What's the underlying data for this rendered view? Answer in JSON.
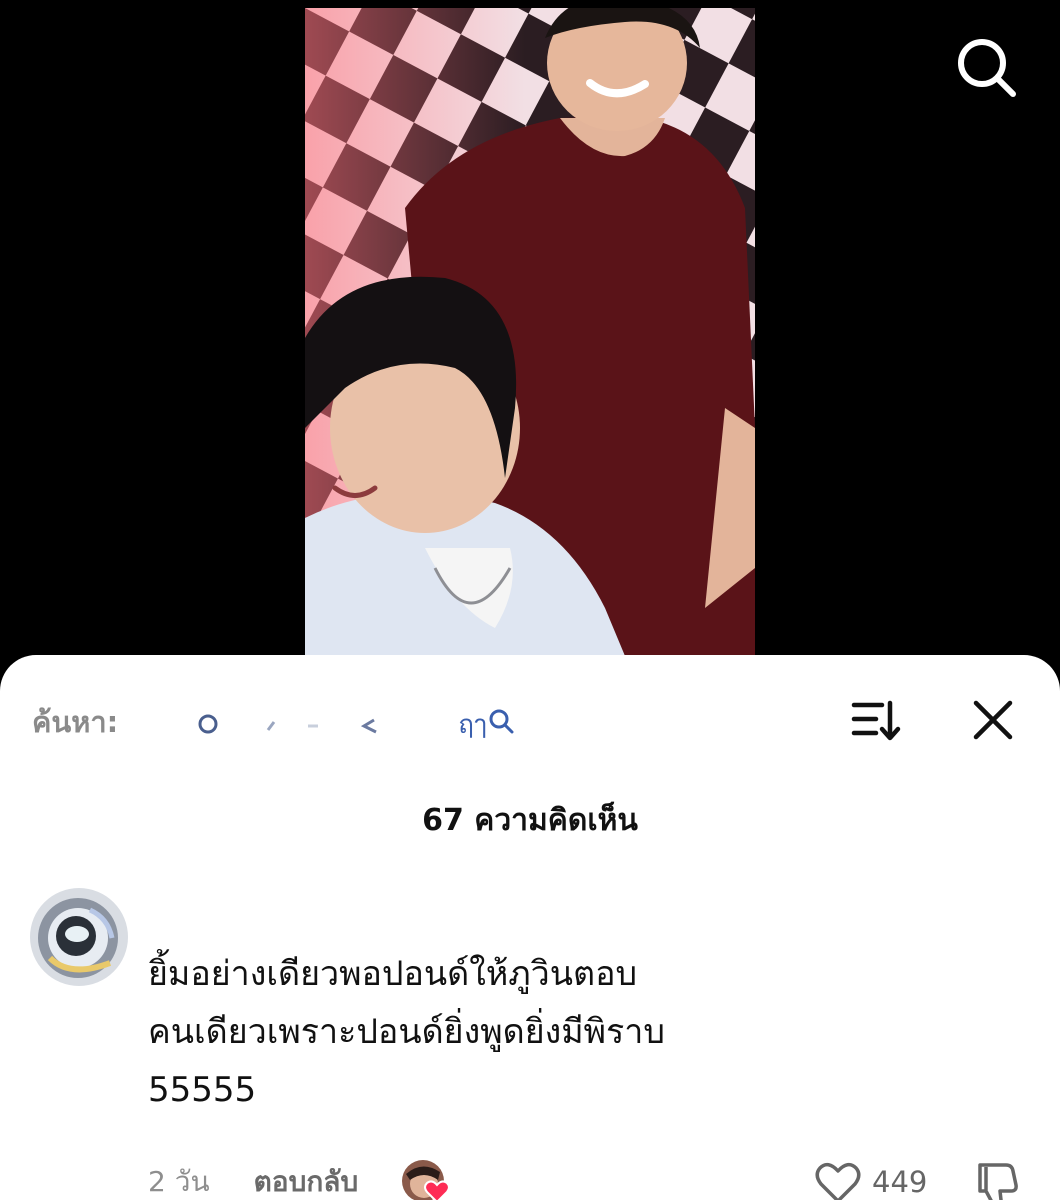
{
  "video": {
    "search_icon": "search-icon"
  },
  "sheet": {
    "search_prefix": "ค้นหา:",
    "search_term": "ฤๅ",
    "sort_icon": "sort-icon",
    "close_icon": "close-icon",
    "comment_count_title": "67 ความคิดเห็น"
  },
  "comment": {
    "text": "ยิ้มอย่างเดียวพอปอนด์ให้ภูวินตอบ\nคนเดียวเพราะปอนด์ยิ่งพูดยิ่งมีพิราบ\n55555",
    "time": "2 วัน",
    "reply_label": "ตอบกลับ",
    "like_count": "449"
  },
  "colors": {
    "accent_heart": "#fe2c55",
    "sheet_bg": "#ffffff",
    "video_bg": "#000000"
  }
}
